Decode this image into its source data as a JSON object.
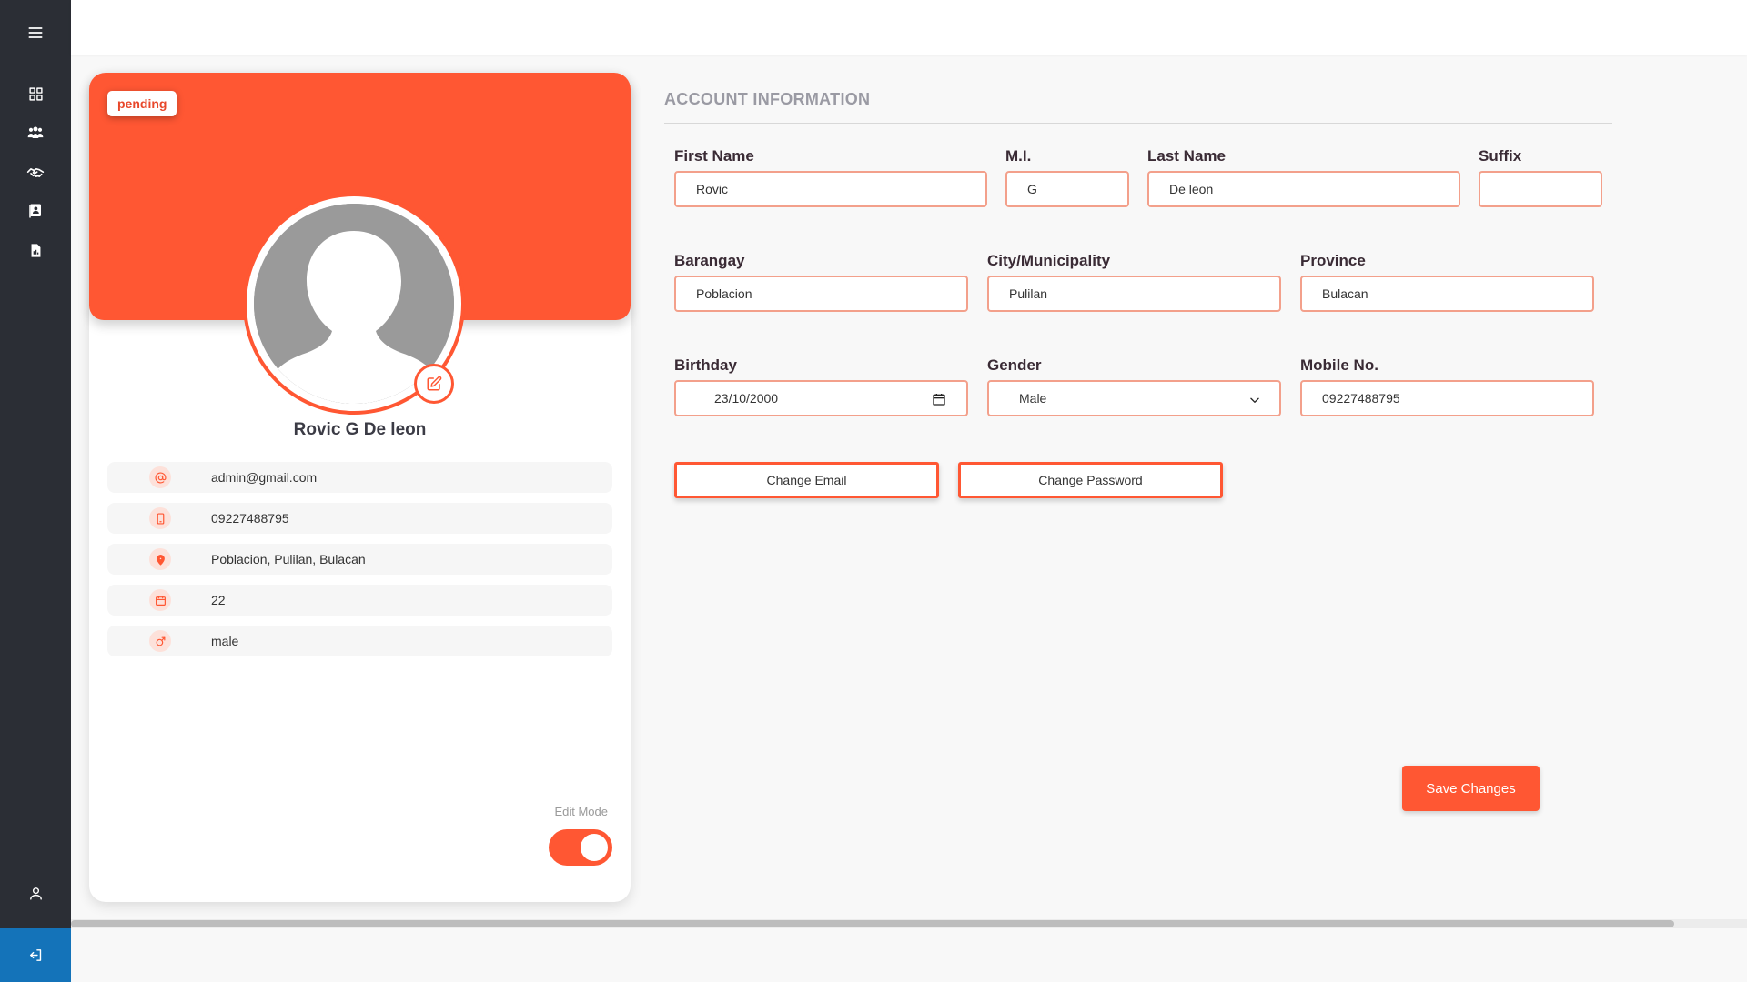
{
  "sidebar": {
    "items": [
      {
        "icon": "menu-icon"
      },
      {
        "icon": "dashboard-grid-icon"
      },
      {
        "icon": "users-group-icon"
      },
      {
        "icon": "handshake-icon"
      },
      {
        "icon": "contacts-book-icon"
      },
      {
        "icon": "report-document-icon"
      }
    ],
    "profile_icon": "user-icon",
    "logout_icon": "logout-icon"
  },
  "profile": {
    "status_badge": "pending",
    "full_name": "Rovic G De leon",
    "details": [
      {
        "icon": "at-icon",
        "value": "admin@gmail.com"
      },
      {
        "icon": "phone-icon",
        "value": "09227488795"
      },
      {
        "icon": "location-pin-icon",
        "value": "Poblacion, Pulilan, Bulacan"
      },
      {
        "icon": "calendar-icon",
        "value": "22"
      },
      {
        "icon": "male-icon",
        "value": "male"
      }
    ],
    "edit_mode_label": "Edit Mode",
    "edit_mode_on": true
  },
  "account": {
    "title": "ACCOUNT INFORMATION",
    "first_name": {
      "label": "First Name",
      "value": "Rovic"
    },
    "middle_initial": {
      "label": "M.I.",
      "value": "G"
    },
    "last_name": {
      "label": "Last Name",
      "value": "De leon"
    },
    "suffix": {
      "label": "Suffix",
      "value": ""
    },
    "barangay": {
      "label": "Barangay",
      "value": "Poblacion"
    },
    "city": {
      "label": "City/Municipality",
      "value": "Pulilan"
    },
    "province": {
      "label": "Province",
      "value": "Bulacan"
    },
    "birthday": {
      "label": "Birthday",
      "value": "23/10/2000"
    },
    "gender": {
      "label": "Gender",
      "value": "Male"
    },
    "mobile": {
      "label": "Mobile No.",
      "value": "09227488795"
    },
    "change_email_label": "Change Email",
    "change_password_label": "Change Password",
    "save_label": "Save Changes"
  },
  "colors": {
    "accent": "#ff5733",
    "sidebar": "#2b2e35",
    "logout": "#1473b9"
  }
}
